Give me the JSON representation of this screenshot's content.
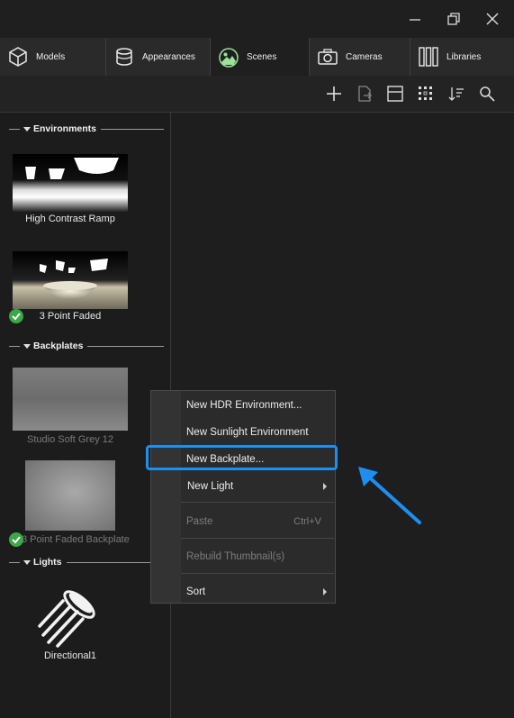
{
  "window": {
    "minimize_icon": "minimize-icon",
    "restore_icon": "restore-icon",
    "close_icon": "close-icon"
  },
  "tabs": [
    {
      "label": "Models",
      "icon": "cube-icon"
    },
    {
      "label": "Appearances",
      "icon": "cylinder-icon"
    },
    {
      "label": "Scenes",
      "icon": "landscape-icon",
      "active": true
    },
    {
      "label": "Cameras",
      "icon": "camera-icon"
    },
    {
      "label": "Libraries",
      "icon": "books-icon"
    }
  ],
  "toolbar": {
    "icons": [
      "plus-icon",
      "export-icon",
      "layout-icon",
      "grid-view-icon",
      "sort-icon",
      "search-icon"
    ]
  },
  "sections": {
    "environments": "Environments",
    "backplates": "Backplates",
    "lights": "Lights"
  },
  "items": {
    "env1": "High Contrast Ramp",
    "env2": "3 Point Faded",
    "bp1": "Studio Soft Grey 12",
    "bp2": "3 Point Faded Backplate",
    "light1": "Directional1"
  },
  "context_menu": {
    "new_hdr": "New HDR Environment...",
    "new_sunlight": "New Sunlight Environment",
    "new_backplate": "New Backplate...",
    "new_light": "New Light",
    "paste": "Paste",
    "paste_shortcut": "Ctrl+V",
    "rebuild": "Rebuild Thumbnail(s)",
    "sort": "Sort"
  },
  "colors": {
    "highlight": "#1c8ff0",
    "check": "#3aa846"
  }
}
